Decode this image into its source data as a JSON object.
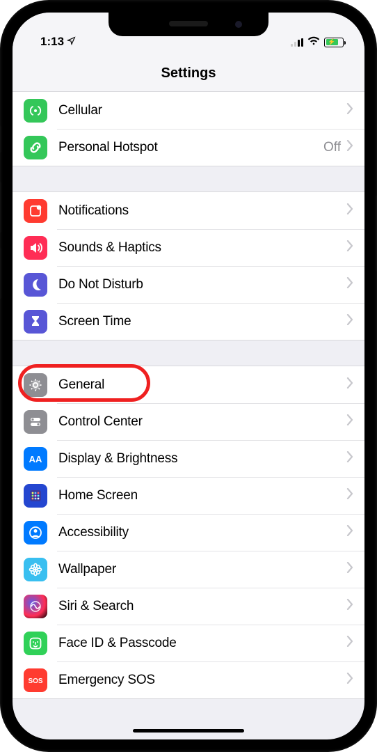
{
  "status": {
    "time": "1:13",
    "battery_pct": 65
  },
  "title": "Settings",
  "groups": [
    {
      "rows": [
        {
          "key": "cellular",
          "label": "Cellular",
          "detail": "",
          "icon": "antenna",
          "bg": "bg-green"
        },
        {
          "key": "hotspot",
          "label": "Personal Hotspot",
          "detail": "Off",
          "icon": "link",
          "bg": "bg-green"
        }
      ]
    },
    {
      "rows": [
        {
          "key": "notifications",
          "label": "Notifications",
          "detail": "",
          "icon": "notif",
          "bg": "bg-red"
        },
        {
          "key": "sounds",
          "label": "Sounds & Haptics",
          "detail": "",
          "icon": "speaker",
          "bg": "bg-pink"
        },
        {
          "key": "dnd",
          "label": "Do Not Disturb",
          "detail": "",
          "icon": "moon",
          "bg": "bg-purple"
        },
        {
          "key": "screentime",
          "label": "Screen Time",
          "detail": "",
          "icon": "hourglass",
          "bg": "bg-purple"
        }
      ]
    },
    {
      "rows": [
        {
          "key": "general",
          "label": "General",
          "detail": "",
          "icon": "gear",
          "bg": "bg-gray",
          "highlight": true
        },
        {
          "key": "controlcenter",
          "label": "Control Center",
          "detail": "",
          "icon": "toggles",
          "bg": "bg-gray"
        },
        {
          "key": "display",
          "label": "Display & Brightness",
          "detail": "",
          "icon": "aa",
          "bg": "bg-blue"
        },
        {
          "key": "homescreen",
          "label": "Home Screen",
          "detail": "",
          "icon": "grid",
          "bg": "bg-darkblue"
        },
        {
          "key": "accessibility",
          "label": "Accessibility",
          "detail": "",
          "icon": "person",
          "bg": "bg-blue"
        },
        {
          "key": "wallpaper",
          "label": "Wallpaper",
          "detail": "",
          "icon": "flower",
          "bg": "bg-teal"
        },
        {
          "key": "siri",
          "label": "Siri & Search",
          "detail": "",
          "icon": "siri",
          "bg": "bg-black"
        },
        {
          "key": "faceid",
          "label": "Face ID & Passcode",
          "detail": "",
          "icon": "face",
          "bg": "bg-green2"
        },
        {
          "key": "sos",
          "label": "Emergency SOS",
          "detail": "",
          "icon": "sos",
          "bg": "bg-red"
        }
      ]
    }
  ]
}
